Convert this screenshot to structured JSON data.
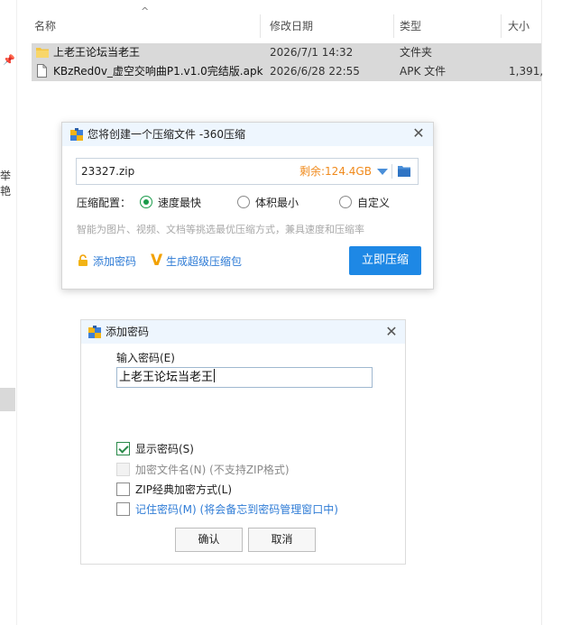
{
  "explorer": {
    "columns": {
      "name": "名称",
      "modified": "修改日期",
      "type": "类型",
      "size": "大小"
    },
    "left_pane_text": "举艳",
    "files": [
      {
        "name": "上老王论坛当老王",
        "date": "2026/7/1 14:32",
        "type": "文件夹",
        "size": "",
        "icon": "folder-icon"
      },
      {
        "name": "KBzRed0v_虚空交响曲P1.v1.0完结版.apk",
        "date": "2026/6/28 22:55",
        "type": "APK 文件",
        "size": "1,391,",
        "icon": "file-icon"
      }
    ]
  },
  "compress_dialog": {
    "title": "您将创建一个压缩文件 -360压缩",
    "path": "23327.zip",
    "free_space": "剩余:124.4GB",
    "config_label": "压缩配置：",
    "options": [
      "速度最快",
      "体积最小",
      "自定义"
    ],
    "selected_option": "速度最快",
    "hint": "智能为图片、视频、文档等挑选最优压缩方式，兼具速度和压缩率",
    "add_password": "添加密码",
    "super_package": "生成超级压缩包",
    "compress_now": "立即压缩",
    "accent_color": "#1e88e5",
    "free_space_color": "#f08a1c"
  },
  "password_dialog": {
    "title": "添加密码",
    "input_label": "输入密码(E)",
    "password_value": "上老王论坛当老王",
    "checkboxes": [
      {
        "label": "显示密码(S)",
        "checked": true,
        "enabled": true
      },
      {
        "label": "加密文件名(N) (不支持ZIP格式)",
        "checked": false,
        "enabled": false
      },
      {
        "label": "ZIP经典加密方式(L)",
        "checked": false,
        "enabled": true
      },
      {
        "label": "记住密码(M) (将会备忘到密码管理窗口中)",
        "checked": false,
        "enabled": true
      }
    ],
    "ok": "确认",
    "cancel": "取消"
  }
}
